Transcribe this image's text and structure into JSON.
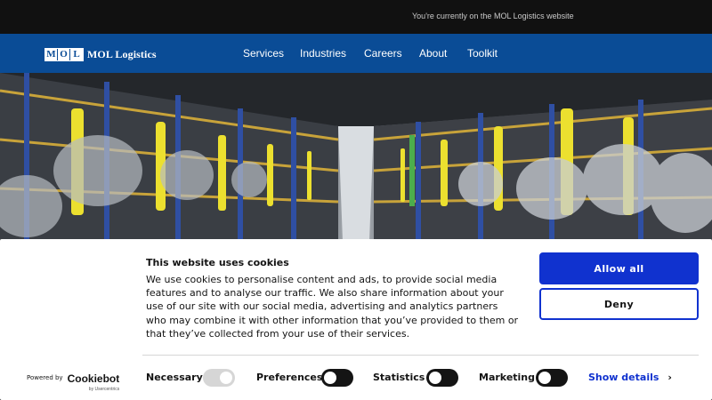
{
  "topbar": {
    "notice": "You're currently on the MOL Logistics website"
  },
  "header": {
    "logo_letters": [
      "M",
      "O",
      "L"
    ],
    "logo_text": "MOL Logistics",
    "nav": [
      "Services",
      "Industries",
      "Careers",
      "About",
      "Toolkit"
    ]
  },
  "cookie": {
    "title": "This website uses cookies",
    "text": "We use cookies to personalise content and ads, to provide social media features and to analyse our traffic. We also share information about your use of our site with our social media, advertising and analytics partners who may combine it with other information that you’ve provided to them or that they’ve collected from your use of their services.",
    "allow_label": "Allow all",
    "deny_label": "Deny",
    "powered_by": "Powered by",
    "brand": "Cookiebot",
    "brand_sub": "by Usercentrics",
    "categories": [
      {
        "label": "Necessary",
        "checked": true
      },
      {
        "label": "Preferences",
        "checked": false
      },
      {
        "label": "Statistics",
        "checked": false
      },
      {
        "label": "Marketing",
        "checked": false
      }
    ],
    "details_label": "Show details"
  },
  "colors": {
    "nav": "#0a4c96",
    "accent": "#1032cf",
    "topbar": "#111111"
  },
  "icons": {
    "details_chevron": "chevron-right-icon"
  }
}
